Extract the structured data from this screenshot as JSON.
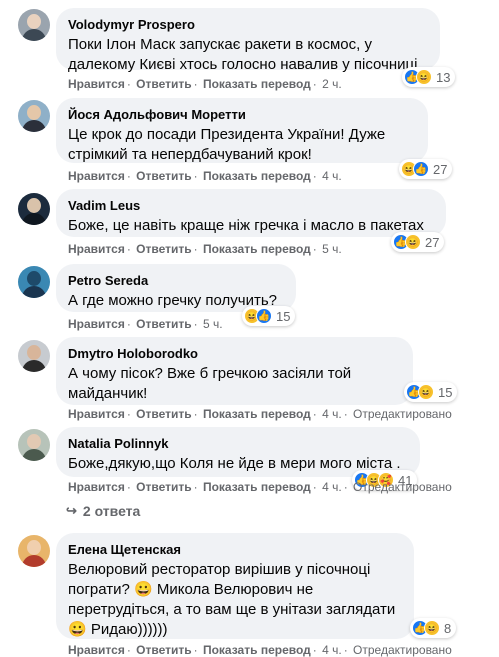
{
  "labels": {
    "like": "Нравится",
    "reply": "Ответить",
    "translate": "Показать перевод",
    "edited": "Отредактировано"
  },
  "comments": [
    {
      "author": "Volodymyr Prospero",
      "lines": [
        "Поки Ілон Маск запускає ракети в космос, у",
        "далекому Києві хтось голосно навалив у пісочниці"
      ],
      "time": "2 ч.",
      "show_translate": true,
      "edited": false,
      "reactions": [
        "like",
        "haha"
      ],
      "count": "13",
      "avatar_colors": {
        "bg": "#9aa4ae",
        "face": "#e9d2bf",
        "body": "#3c4854"
      }
    },
    {
      "author": "Йося Адольфович Моретти",
      "lines": [
        "Це крок до посади Президента України! Дуже",
        "стрімкий та непердбачуваний крок!"
      ],
      "time": "4 ч.",
      "show_translate": true,
      "edited": false,
      "reactions": [
        "haha",
        "like"
      ],
      "count": "27",
      "avatar_colors": {
        "bg": "#8fb0c8",
        "face": "#e4c7a9",
        "body": "#2b2f3a"
      }
    },
    {
      "author": "Vadim Leus",
      "lines": [
        "Боже, це навіть краще ніж гречка і масло в пакетах"
      ],
      "time": "5 ч.",
      "show_translate": true,
      "edited": false,
      "reactions": [
        "like",
        "haha"
      ],
      "count": "27",
      "avatar_colors": {
        "bg": "#1c2b3d",
        "face": "#d9c2aa",
        "body": "#0f1720"
      }
    },
    {
      "author": "Petro Sereda",
      "lines": [
        "А где можно гречку получить?"
      ],
      "time": "5 ч.",
      "show_translate": false,
      "edited": false,
      "reactions": [
        "haha",
        "like"
      ],
      "count": "15",
      "avatar_colors": {
        "bg": "#3a88b3",
        "face": "#1e4a6a",
        "body": "#1a3550"
      }
    },
    {
      "author": "Dmytro Holoborodko",
      "lines": [
        "А чому пісок? Вже б гречкою засіяли той",
        "майданчик!"
      ],
      "time": "4 ч.",
      "show_translate": true,
      "edited": true,
      "reactions": [
        "like",
        "haha"
      ],
      "count": "15",
      "avatar_colors": {
        "bg": "#c7cbd0",
        "face": "#d8b59a",
        "body": "#2a2a2a"
      }
    },
    {
      "author": "Natalia Polinnyk",
      "lines": [
        "Боже,дякую,що Коля не йде в мери мого міста ."
      ],
      "time": "4 ч.",
      "show_translate": true,
      "edited": true,
      "reactions": [
        "like",
        "haha",
        "care"
      ],
      "count": "41",
      "avatar_colors": {
        "bg": "#b7c3b9",
        "face": "#e2c9b3",
        "body": "#4b5a4e"
      }
    },
    {
      "author": "Елена Щетенская",
      "lines": [
        "Велюровий ресторатор вирішив у пісочноці",
        "пограти? 😀 Микола Велюрович не",
        "перетрудіться, а то вам ще в унітази заглядати",
        "😀 Ридаю))))))"
      ],
      "time": "4 ч.",
      "show_translate": true,
      "edited": true,
      "reactions": [
        "like",
        "haha"
      ],
      "count": "8",
      "avatar_colors": {
        "bg": "#e8b56a",
        "face": "#f0cfae",
        "body": "#b23c2c"
      }
    }
  ],
  "replies_link": "2 ответа"
}
